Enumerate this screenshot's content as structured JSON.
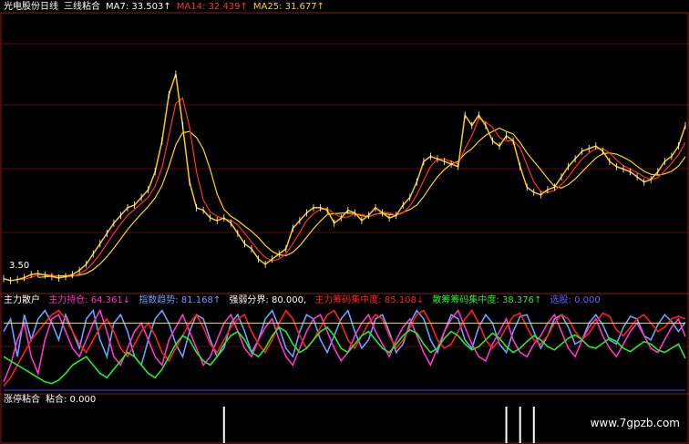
{
  "colors": {
    "bg": "#000000",
    "frame": "#8b1a1a",
    "grid": "#7a1010",
    "ma7": "#ffffff",
    "ma14": "#ff3030",
    "ma25": "#ffd700",
    "price": "#ffcc00",
    "zhuli": "#ff33cc",
    "zhishu": "#6aa0ff",
    "qiangruo": "#ffffff",
    "zlcm": "#ff2020",
    "shcm": "#22ee22",
    "xuanze": "#6060ff",
    "hline_yellow": "#e8e060",
    "hline_blue": "#3050ff"
  },
  "panel1": {
    "title": "光电股份日线",
    "subtitle": "三线粘合",
    "ma7_label": "MA7: 33.503↑",
    "ma14_label": "MA14: 32.439↑",
    "ma25_label": "MA25: 31.677↑",
    "low_label": "3.50"
  },
  "panel2": {
    "title": "主力散户",
    "items": [
      {
        "text": "主力持仓: 64.361↓",
        "color": "#ff33cc"
      },
      {
        "text": "指数趋势: 81.168↑",
        "color": "#6aa0ff"
      },
      {
        "text": "强弱分界: 80.000,",
        "color": "#ffffff"
      },
      {
        "text": "主力筹码集中度: 85.108↓",
        "color": "#ff2020"
      },
      {
        "text": "散筹筹码集中度: 38.376↑",
        "color": "#22ee22"
      },
      {
        "text": "选股: 0.000",
        "color": "#6060ff"
      }
    ]
  },
  "panel3": {
    "title": "涨停粘合",
    "value": "粘合: 0.000"
  },
  "watermark": "www.7gpzb.com",
  "chart_data": [
    {
      "type": "line",
      "name": "price",
      "title": "光电股份日线",
      "x_count": 100,
      "series": [
        {
          "name": "",
          "values": [
            3.62,
            3.58,
            3.6,
            3.64,
            3.7,
            3.72,
            3.69,
            3.66,
            3.63,
            3.66,
            3.7,
            3.78,
            3.9,
            4.1,
            4.3,
            4.5,
            4.7,
            4.85,
            5.0,
            5.05,
            5.2,
            5.35,
            5.7,
            6.3,
            7.2,
            7.6,
            6.6,
            5.5,
            5.0,
            4.95,
            4.8,
            4.75,
            4.8,
            4.7,
            4.5,
            4.3,
            4.2,
            4.0,
            3.9,
            4.0,
            4.1,
            4.2,
            4.6,
            4.75,
            4.9,
            5.0,
            5.0,
            4.95,
            4.7,
            4.8,
            4.95,
            4.9,
            4.75,
            4.85,
            5.0,
            4.9,
            4.8,
            4.85,
            5.05,
            5.2,
            5.5,
            5.9,
            6.0,
            5.95,
            5.9,
            5.85,
            5.8,
            6.8,
            6.6,
            6.8,
            6.6,
            6.3,
            6.2,
            6.4,
            6.3,
            5.8,
            5.4,
            5.3,
            5.25,
            5.35,
            5.4,
            5.6,
            5.8,
            5.95,
            6.1,
            6.15,
            6.2,
            6.1,
            5.9,
            5.8,
            5.75,
            5.7,
            5.6,
            5.5,
            5.55,
            5.7,
            5.9,
            6.0,
            6.2,
            6.6
          ]
        }
      ]
    },
    {
      "type": "line",
      "name": "zhuli-sanhu",
      "title": "主力散户",
      "ylim": [
        0,
        100
      ],
      "x_count": 100,
      "series": [
        {
          "name": "主力持仓",
          "values": [
            10,
            30,
            60,
            80,
            40,
            20,
            60,
            85,
            90,
            70,
            50,
            40,
            60,
            80,
            95,
            70,
            40,
            30,
            50,
            70,
            80,
            60,
            40,
            30,
            60,
            75,
            90,
            70,
            50,
            30,
            40,
            60,
            80,
            90,
            70,
            50,
            40,
            60,
            75,
            85,
            60,
            40,
            30,
            50,
            70,
            85,
            90,
            70,
            50,
            35,
            45,
            65,
            80,
            90,
            70,
            55,
            40,
            60,
            75,
            85,
            65,
            45,
            30,
            50,
            70,
            85,
            95,
            75,
            55,
            40,
            35,
            55,
            70,
            85,
            60,
            45,
            40,
            55,
            65,
            80,
            90,
            70,
            50,
            40,
            60,
            75,
            85,
            65,
            50,
            40,
            55,
            70,
            80,
            65,
            50,
            45,
            60,
            75,
            85,
            64
          ]
        },
        {
          "name": "指数趋势",
          "values": [
            70,
            85,
            40,
            90,
            60,
            85,
            95,
            80,
            60,
            90,
            70,
            50,
            85,
            95,
            60,
            40,
            80,
            90,
            70,
            40,
            30,
            60,
            85,
            95,
            80,
            55,
            40,
            70,
            90,
            85,
            60,
            40,
            50,
            80,
            90,
            70,
            45,
            60,
            85,
            95,
            75,
            50,
            40,
            70,
            90,
            85,
            60,
            45,
            65,
            85,
            95,
            70,
            50,
            60,
            85,
            90,
            70,
            45,
            55,
            80,
            95,
            85,
            60,
            45,
            70,
            90,
            85,
            60,
            50,
            75,
            90,
            80,
            55,
            45,
            70,
            88,
            90,
            70,
            50,
            65,
            85,
            90,
            75,
            55,
            60,
            80,
            90,
            78,
            60,
            55,
            75,
            88,
            85,
            65,
            60,
            78,
            90,
            82,
            70,
            81
          ]
        },
        {
          "name": "强弱分界",
          "values": [
            80,
            80,
            80,
            80,
            80,
            80,
            80,
            80,
            80,
            80,
            80,
            80,
            80,
            80,
            80,
            80,
            80,
            80,
            80,
            80,
            80,
            80,
            80,
            80,
            80,
            80,
            80,
            80,
            80,
            80,
            80,
            80,
            80,
            80,
            80,
            80,
            80,
            80,
            80,
            80,
            80,
            80,
            80,
            80,
            80,
            80,
            80,
            80,
            80,
            80,
            80,
            80,
            80,
            80,
            80,
            80,
            80,
            80,
            80,
            80,
            80,
            80,
            80,
            80,
            80,
            80,
            80,
            80,
            80,
            80,
            80,
            80,
            80,
            80,
            80,
            80,
            80,
            80,
            80,
            80,
            80,
            80,
            80,
            80,
            80,
            80,
            80,
            80,
            80,
            80,
            80,
            80,
            80,
            80,
            80,
            80,
            80,
            80,
            80,
            80
          ]
        },
        {
          "name": "主力筹码集中度",
          "values": [
            5,
            15,
            30,
            45,
            60,
            70,
            80,
            90,
            95,
            85,
            70,
            55,
            45,
            60,
            75,
            85,
            70,
            50,
            40,
            55,
            70,
            80,
            65,
            45,
            35,
            50,
            65,
            80,
            90,
            75,
            55,
            45,
            60,
            75,
            85,
            90,
            70,
            55,
            45,
            60,
            80,
            95,
            85,
            65,
            50,
            60,
            75,
            90,
            95,
            80,
            60,
            50,
            65,
            80,
            90,
            85,
            65,
            50,
            60,
            75,
            90,
            95,
            80,
            60,
            50,
            55,
            70,
            85,
            95,
            80,
            60,
            50,
            60,
            75,
            88,
            92,
            75,
            60,
            55,
            65,
            80,
            90,
            85,
            70,
            60,
            68,
            80,
            92,
            88,
            72,
            65,
            75,
            85,
            90,
            80,
            70,
            75,
            85,
            88,
            85
          ]
        },
        {
          "name": "散筹筹码集中度",
          "values": [
            40,
            35,
            30,
            25,
            20,
            15,
            10,
            8,
            12,
            20,
            30,
            35,
            40,
            30,
            20,
            15,
            25,
            35,
            45,
            40,
            30,
            20,
            15,
            25,
            40,
            55,
            65,
            60,
            45,
            35,
            30,
            40,
            55,
            65,
            70,
            60,
            45,
            40,
            50,
            65,
            75,
            70,
            55,
            45,
            50,
            60,
            70,
            75,
            65,
            50,
            45,
            55,
            65,
            70,
            60,
            50,
            45,
            55,
            65,
            72,
            68,
            55,
            45,
            50,
            62,
            70,
            65,
            55,
            48,
            52,
            60,
            68,
            62,
            52,
            45,
            50,
            58,
            65,
            60,
            52,
            48,
            55,
            62,
            66,
            60,
            52,
            50,
            56,
            62,
            58,
            50,
            46,
            52,
            58,
            55,
            48,
            45,
            50,
            55,
            38
          ]
        },
        {
          "name": "选股",
          "values": [
            0,
            0,
            0,
            0,
            0,
            0,
            0,
            0,
            0,
            0,
            0,
            0,
            0,
            0,
            0,
            0,
            0,
            0,
            0,
            0,
            0,
            0,
            0,
            0,
            0,
            0,
            0,
            0,
            0,
            0,
            0,
            0,
            0,
            0,
            0,
            0,
            0,
            0,
            0,
            0,
            0,
            0,
            0,
            0,
            0,
            0,
            0,
            0,
            0,
            0,
            0,
            0,
            0,
            0,
            0,
            0,
            0,
            0,
            0,
            0,
            0,
            0,
            0,
            0,
            0,
            0,
            0,
            0,
            0,
            0,
            0,
            0,
            0,
            0,
            0,
            0,
            0,
            0,
            0,
            0,
            0,
            0,
            0,
            0,
            0,
            0,
            0,
            0,
            0,
            0,
            0,
            0,
            0,
            0,
            0,
            0,
            0,
            0,
            0,
            0
          ]
        }
      ]
    },
    {
      "type": "bar",
      "name": "zhangting-nianhe",
      "title": "涨停粘合",
      "x_count": 100,
      "ylim": [
        0,
        1
      ],
      "series": [
        {
          "name": "粘合",
          "values": [
            0,
            0,
            0,
            0,
            0,
            0,
            0,
            0,
            0,
            0,
            0,
            0,
            0,
            0,
            0,
            0,
            0,
            0,
            0,
            0,
            0,
            0,
            0,
            0,
            0,
            0,
            0,
            0,
            0,
            0,
            0,
            0,
            1,
            0,
            0,
            0,
            0,
            0,
            0,
            0,
            0,
            0,
            0,
            0,
            0,
            0,
            0,
            0,
            0,
            0,
            0,
            0,
            0,
            0,
            0,
            0,
            0,
            0,
            0,
            0,
            0,
            0,
            0,
            0,
            0,
            0,
            0,
            0,
            0,
            0,
            0,
            0,
            0,
            1,
            0,
            1,
            0,
            1,
            0,
            0,
            0,
            0,
            0,
            0,
            0,
            0,
            0,
            0,
            0,
            0,
            0,
            0,
            0,
            0,
            0,
            0,
            0,
            0,
            0,
            0
          ]
        }
      ]
    }
  ]
}
